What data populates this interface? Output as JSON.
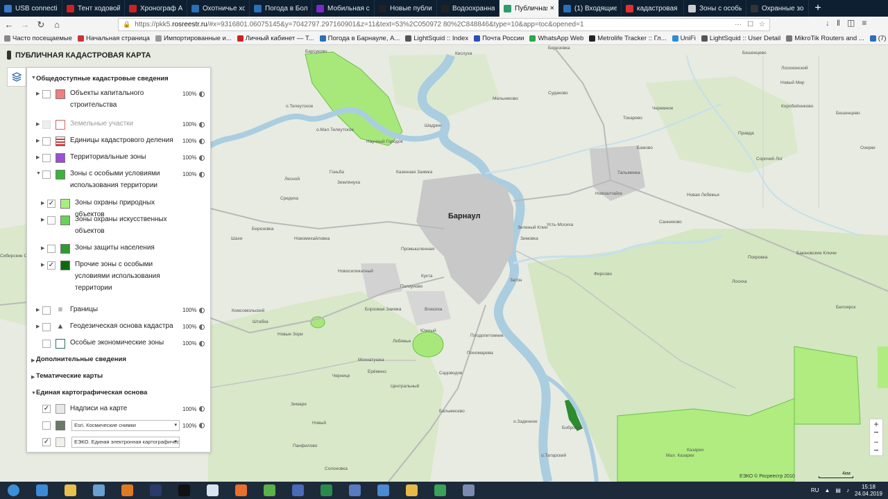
{
  "browser": {
    "tabs": [
      {
        "label": "USB connections",
        "color": "#3a78c8"
      },
      {
        "label": "Тент ходовой с",
        "color": "#cc2222"
      },
      {
        "label": "Хронограф АСС",
        "color": "#cc2222"
      },
      {
        "label": "Охотничье хозяй",
        "color": "#2a6fb8"
      },
      {
        "label": "Погода в Больш",
        "color": "#2a6fb8"
      },
      {
        "label": "Мобильная свяг",
        "color": "#7a2ac8"
      },
      {
        "label": "Новые публика",
        "color": "#222222"
      },
      {
        "label": "Водоохранная з",
        "color": "#222222"
      },
      {
        "label": "Публичная к",
        "color": "#2a9d6a",
        "active": true
      },
      {
        "label": "(1) Входящие - П",
        "color": "#2a6fb8"
      },
      {
        "label": "кадастровая карт",
        "color": "#e03030"
      },
      {
        "label": "Зоны с особыми",
        "color": "#cccccc"
      },
      {
        "label": "Охранные зоны",
        "color": "#333333"
      }
    ],
    "new_tab": "+",
    "url_prefix": "https://pkk5.",
    "url_domain": "rosreestr.ru",
    "url_rest": "/#x=9316801.06075145&y=7042797.297160901&z=11&text=53%2C050972 80%2C848846&type=10&app=toc&opened=1",
    "url_dots": "···",
    "bookmarks": [
      {
        "label": "Часто посещаемые",
        "color": "#888888"
      },
      {
        "label": "Начальная страница",
        "color": "#cc3333"
      },
      {
        "label": "Импортированные и...",
        "color": "#999999"
      },
      {
        "label": "Личный кабинет — Т...",
        "color": "#cc2222"
      },
      {
        "label": "Погода в Барнауле, А...",
        "color": "#2a6fb8"
      },
      {
        "label": "LightSquid :: Index",
        "color": "#555555"
      },
      {
        "label": "Почта России",
        "color": "#2a4fb8"
      },
      {
        "label": "WhatsApp Web",
        "color": "#2aa84a"
      },
      {
        "label": "Metrolife Tracker :: Гл...",
        "color": "#222222"
      },
      {
        "label": "UniFi",
        "color": "#2a8fd8"
      },
      {
        "label": "LightSquid :: User Detail",
        "color": "#555555"
      },
      {
        "label": "MikroTik Routers and ...",
        "color": "#777777"
      },
      {
        "label": "(7) Входящие - Почта...",
        "color": "#2a6fb8"
      }
    ]
  },
  "app": {
    "title": "ПУБЛИЧНАЯ КАДАСТРОВАЯ КАРТА"
  },
  "panel": {
    "section_general": "Общедоступные кадастровые сведения",
    "layers": [
      {
        "label": "Объекты капитального строительства",
        "pct": "100%",
        "swatch": "#f07f7f",
        "checked": false
      },
      {
        "label": "Земельные участки",
        "pct": "100%",
        "swatch": "#ffffff",
        "checked": false
      },
      {
        "label": "Единицы кадастрового деления",
        "pct": "100%",
        "swatch": "#d33",
        "checked": false
      },
      {
        "label": "Территориальные зоны",
        "pct": "100%",
        "swatch": "#9a4fd4",
        "checked": false
      },
      {
        "label": "Зоны с особыми условиями использования территории",
        "pct": "100%",
        "swatch": "#3cb43c",
        "checked": false
      }
    ],
    "sublayers": [
      {
        "label": "Зоны охраны природных объектов",
        "swatch": "#a6f07e",
        "checked": true
      },
      {
        "label": "Зоны охраны искусственных объектов",
        "swatch": "#6bd05a",
        "checked": false
      },
      {
        "label": "Зоны защиты населения",
        "swatch": "#2f9a2f",
        "checked": false
      },
      {
        "label": "Прочие зоны с особыми условиями использования территории",
        "swatch": "#0c6a0c",
        "checked": true
      }
    ],
    "layers2": [
      {
        "label": "Границы",
        "pct": "100%"
      },
      {
        "label": "Геодезическая основа кадастра",
        "pct": "100%"
      },
      {
        "label": "Особые экономические зоны",
        "pct": "100%"
      }
    ],
    "section_additional": "Дополнительные сведения",
    "section_thematic": "Тематические карты",
    "section_base": "Единая картографическая основа",
    "base_layers": [
      {
        "label": "Надписи на карте",
        "pct": "100%",
        "checked": true
      },
      {
        "select": "Esri. Космические снимки",
        "pct": "100%",
        "checked": false
      },
      {
        "select": "ЕЭКО. Единая электронная картографичес",
        "checked": true
      }
    ],
    "check_mark": "✓",
    "dropdown_mark": "▾"
  },
  "map": {
    "city": "Барнаул",
    "labels": [
      {
        "text": "Барсуково"
      },
      {
        "text": "Кислуха"
      },
      {
        "text": "Березовка"
      },
      {
        "text": "о.Телеутское"
      },
      {
        "text": "о.Мал.Телеутское"
      },
      {
        "text": "Научный Городок"
      },
      {
        "text": "Шадрин"
      },
      {
        "text": "Мельниково"
      },
      {
        "text": "Гоньба"
      },
      {
        "text": "Казенная Заимка"
      },
      {
        "text": "Землянуха"
      },
      {
        "text": "Лесной"
      },
      {
        "text": "Березовка"
      },
      {
        "text": "Средиха"
      },
      {
        "text": "Шахи"
      },
      {
        "text": "Новомихайловка"
      },
      {
        "text": "Промышленная"
      },
      {
        "text": "Новосиликатный"
      },
      {
        "text": "Кукта"
      },
      {
        "text": "Ползуново"
      },
      {
        "text": "Власиха"
      },
      {
        "text": "Штабка"
      },
      {
        "text": "Комсомольский"
      },
      {
        "text": "Новые Зори"
      },
      {
        "text": "Борзовая Заимка"
      },
      {
        "text": "Южный"
      },
      {
        "text": "Лебяжье"
      },
      {
        "text": "Плодопитомник"
      },
      {
        "text": "Пономарева"
      },
      {
        "text": "Садоводов"
      },
      {
        "text": "Мохнатушка"
      },
      {
        "text": "Черницк"
      },
      {
        "text": "Ерёмино"
      },
      {
        "text": "Центральный"
      },
      {
        "text": "Зимари"
      },
      {
        "text": "Новый"
      },
      {
        "text": "Панфилово"
      },
      {
        "text": "Солоновка"
      },
      {
        "text": "Бельмесево"
      },
      {
        "text": "о.Заденное"
      },
      {
        "text": "Бобровка"
      },
      {
        "text": "о.Татарский"
      },
      {
        "text": "Затон"
      },
      {
        "text": "Зеленый Клин"
      },
      {
        "text": "Усть-Мосиха"
      },
      {
        "text": "Зимовка"
      },
      {
        "text": "Фирсово"
      },
      {
        "text": "Лосиха"
      },
      {
        "text": "Покровка"
      },
      {
        "text": "Бажово"
      },
      {
        "text": "Новоалтайск"
      },
      {
        "text": "Тальменка"
      },
      {
        "text": "Санниково"
      },
      {
        "text": "Токарево"
      },
      {
        "text": "Черемное"
      },
      {
        "text": "Правда"
      },
      {
        "text": "Новый Мир"
      },
      {
        "text": "Бешенцево"
      },
      {
        "text": "Лосихинский"
      },
      {
        "text": "Баюновские Ключи"
      },
      {
        "text": "Казарки"
      },
      {
        "text": "Мал. Казарки"
      },
      {
        "text": "Судаково"
      },
      {
        "text": "Новая Лебяжья"
      },
      {
        "text": "Сибирские Огни"
      },
      {
        "text": "Коробейниково"
      },
      {
        "text": "Бешенцево"
      },
      {
        "text": "Озерки"
      },
      {
        "text": "Белоярск"
      },
      {
        "text": "Сорочий Лог"
      }
    ],
    "attribution": "ЕЭКО © Росреестр 2010",
    "scale": "4км",
    "zoom_in": "+",
    "zoom_out": "−",
    "zoom_dots": "•••"
  },
  "taskbar": {
    "items": [
      {
        "name": "start",
        "color": "#3b8fd8"
      },
      {
        "name": "internet-explorer",
        "color": "#3a8ad8"
      },
      {
        "name": "file-explorer",
        "color": "#e8c050"
      },
      {
        "name": "virtualbox",
        "color": "#6aa0d0"
      },
      {
        "name": "media-player",
        "color": "#e07a20"
      },
      {
        "name": "powershell",
        "color": "#2a3a6a"
      },
      {
        "name": "terminal",
        "color": "#111111"
      },
      {
        "name": "notepad",
        "color": "#d8e4f0"
      },
      {
        "name": "firefox",
        "color": "#e8702a"
      },
      {
        "name": "app-green",
        "color": "#5ab04a"
      },
      {
        "name": "network-tool",
        "color": "#4a6ab8"
      },
      {
        "name": "excel",
        "color": "#2a8a4a"
      },
      {
        "name": "remote-desktop",
        "color": "#5a7ac0"
      },
      {
        "name": "chrome-like",
        "color": "#4a8ad0"
      },
      {
        "name": "folder",
        "color": "#e8b848"
      },
      {
        "name": "monitor",
        "color": "#3aa05a"
      },
      {
        "name": "brush",
        "color": "#7a8ab0"
      }
    ],
    "lang": "RU",
    "time": "15:18",
    "date": "24.04.2019"
  }
}
